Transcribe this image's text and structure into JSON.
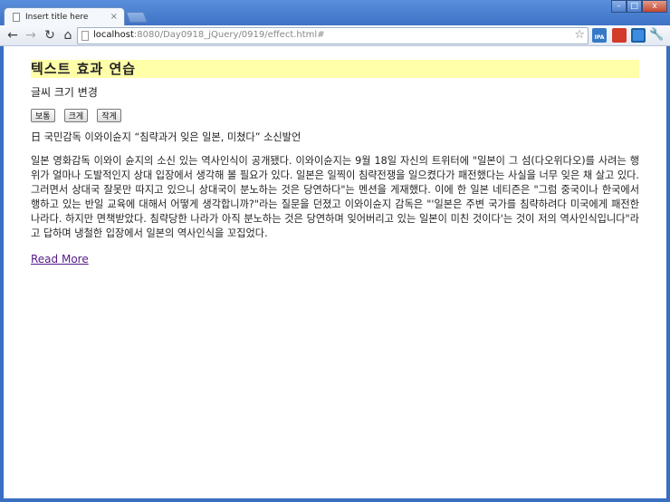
{
  "browser": {
    "tab_title": "Insert title here",
    "tab_close": "×",
    "url_host": "localhost",
    "url_rest": ":8080/Day0918_jQuery/0919/effect.html#",
    "window_controls": {
      "minimize": "–",
      "maximize": "□",
      "close": "x"
    },
    "icons": {
      "back": "back-arrow-icon",
      "forward": "forward-arrow-icon",
      "reload": "reload-icon",
      "home": "home-icon",
      "bookmark_star": "star-icon",
      "wrench": "wrench-icon"
    },
    "ext_ipa_label": "IPA"
  },
  "page": {
    "heading": "텍스트 효과 연습",
    "subtitle": "글씨 크기 변경",
    "buttons": [
      "보통",
      "크게",
      "작게"
    ],
    "article_title": "日 국민감독 이와이슌지 “침략과거 잊은 일본, 미쳤다” 소신발언",
    "article_body": "일본 영화감독 이와이 슌지의 소신 있는 역사인식이 공개됐다. 이와이슌지는 9월 18일 자신의 트위터에 \"일본이 그 섬(다오위다오)를 사려는 행위가 얼마나 도발적인지 상대 입장에서 생각해 볼 필요가 있다. 일본은 일찍이 침략전쟁을 일으켰다가 패전했다는 사실을 너무 잊은 채 살고 있다. 그러면서 상대국 잘못만 따지고 있으니 상대국이 분노하는 것은 당연하다\"는 멘션을 게재했다. 이에 한 일본 네티즌은 \"그럼 중국이나 한국에서 행하고 있는 반일 교육에 대해서 어떻게 생각합니까?\"라는 질문을 던졌고 이와이슌지 감독은 \"'일본은 주변 국가를 침략하려다 미국에게 패전한 나라다. 하지만 면책받았다. 침략당한 나라가 아직 분노하는 것은 당연하며 잊어버리고 있는 일본이 미친 것이다'는 것이 저의 역사인식입니다\"라고 답하며 냉철한 입장에서 일본의 역사인식을 꼬집었다.",
    "read_more": "Read More"
  }
}
